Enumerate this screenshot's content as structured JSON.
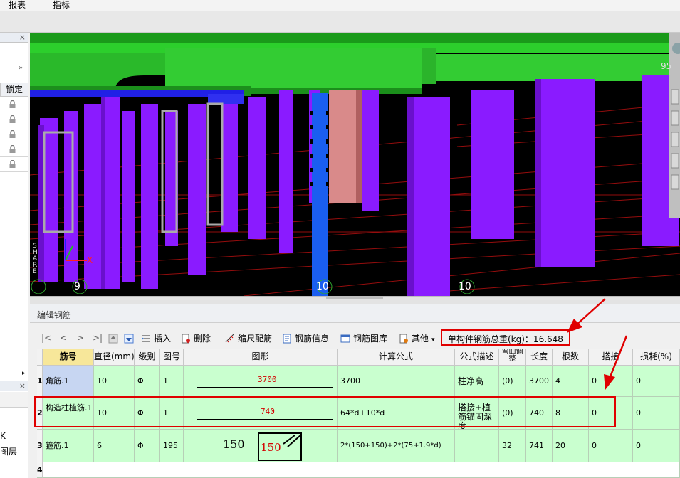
{
  "menu": {
    "items": [
      "报表",
      "指标"
    ]
  },
  "left_panel": {
    "lock_header": "锁定",
    "lock_rows": 5,
    "tab_label": "图层",
    "tab_label2": "K"
  },
  "viewport": {
    "axis_labels": [
      "9",
      "10",
      "10",
      "95"
    ],
    "side_text": "SHARE"
  },
  "editor": {
    "title": "编辑钢筋",
    "toolbar": {
      "nav": [
        "|<",
        "<",
        ">",
        ">|"
      ],
      "insert": "插入",
      "delete": "删除",
      "scale_rebar": "缩尺配筋",
      "rebar_info": "钢筋信息",
      "rebar_library": "钢筋图库",
      "other": "其他",
      "total_weight": "单构件钢筋总重(kg)：16.648"
    },
    "columns": [
      "筋号",
      "直径(mm)",
      "级别",
      "图号",
      "图形",
      "计算公式",
      "公式描述",
      "弯曲调整",
      "长度",
      "根数",
      "搭接",
      "损耗(%)"
    ],
    "rows": [
      {
        "num": "1",
        "name": "角筋.1",
        "dia": "10",
        "grade": "Φ",
        "fig": "1",
        "shape_value": "3700",
        "formula": "3700",
        "desc": "柱净高",
        "bend": "(0)",
        "length": "3700",
        "count": "4",
        "lap": "0",
        "loss": "0"
      },
      {
        "num": "2",
        "name": "构造柱植筋.1",
        "dia": "10",
        "grade": "Φ",
        "fig": "1",
        "shape_value": "740",
        "formula": "64*d+10*d",
        "desc": "搭接+植筋锚固深度",
        "bend": "(0)",
        "length": "740",
        "count": "8",
        "lap": "0",
        "loss": "0"
      },
      {
        "num": "3",
        "name": "箍筋.1",
        "dia": "6",
        "grade": "Φ",
        "fig": "195",
        "shape_value": "150",
        "shape_value2": "150",
        "formula": "2*(150+150)+2*(75+1.9*d)",
        "desc": "",
        "bend": "32",
        "length": "741",
        "count": "20",
        "lap": "0",
        "loss": "0"
      },
      {
        "num": "4"
      }
    ]
  }
}
